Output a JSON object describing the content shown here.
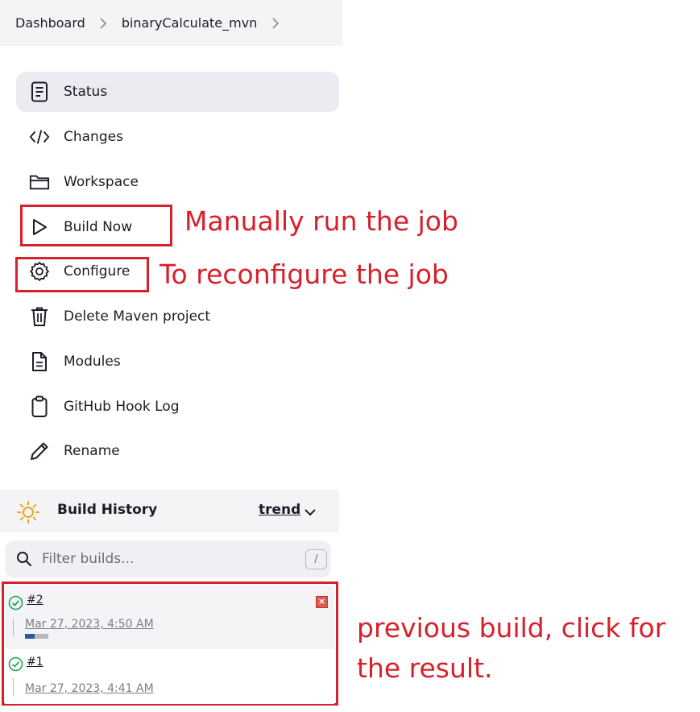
{
  "breadcrumb": {
    "items": [
      "Dashboard",
      "binaryCalculate_mvn"
    ],
    "separator": ">"
  },
  "menu": {
    "items": [
      {
        "label": "Status",
        "icon": "status-icon"
      },
      {
        "label": "Changes",
        "icon": "code-icon"
      },
      {
        "label": "Workspace",
        "icon": "folder-icon"
      },
      {
        "label": "Build Now",
        "icon": "play-icon"
      },
      {
        "label": "Configure",
        "icon": "gear-icon"
      },
      {
        "label": "Delete Maven project",
        "icon": "trash-icon"
      },
      {
        "label": "Modules",
        "icon": "document-icon"
      },
      {
        "label": "GitHub Hook Log",
        "icon": "clipboard-icon"
      },
      {
        "label": "Rename",
        "icon": "pencil-icon"
      }
    ]
  },
  "annotations": {
    "build_now": "Manually run the job",
    "configure": "To reconfigure the job",
    "builds": "previous build, click for the result."
  },
  "build_history": {
    "title": "Build History",
    "trend_label": "trend",
    "filter_placeholder": "Filter builds...",
    "shortcut_key": "/",
    "builds": [
      {
        "number": "#2",
        "date": "Mar 27, 2023, 4:50 AM",
        "status": "success",
        "progress": 0.4
      },
      {
        "number": "#1",
        "date": "Mar 27, 2023, 4:41 AM",
        "status": "success"
      }
    ]
  },
  "colors": {
    "annotation": "#d8202c",
    "success": "#1ea64b",
    "accent": "#2d5aa6"
  }
}
